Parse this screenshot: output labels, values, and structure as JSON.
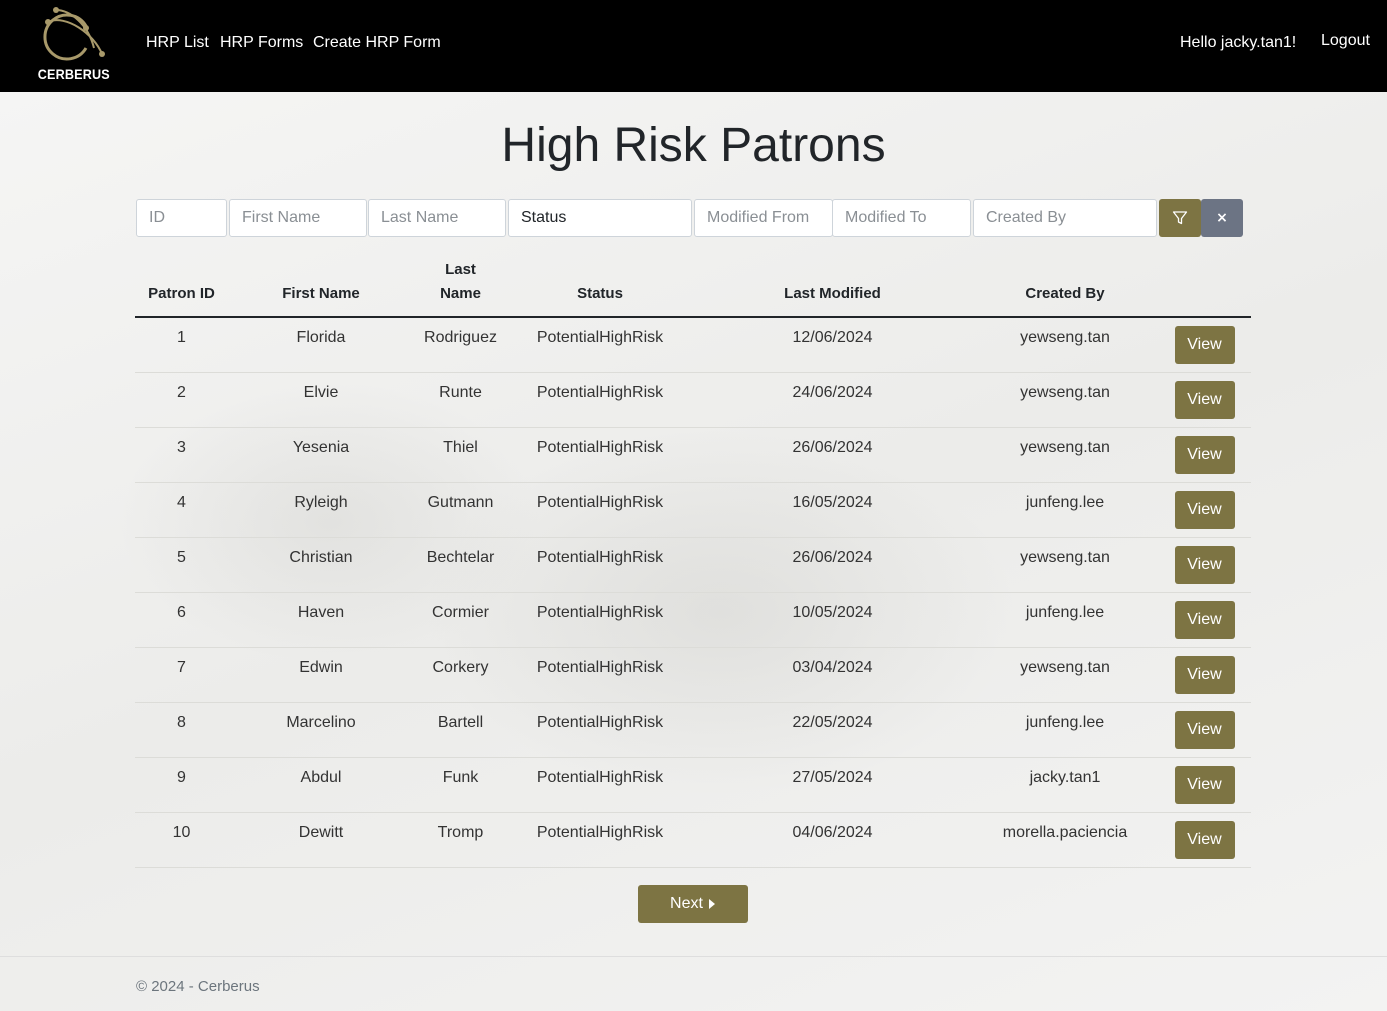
{
  "brand": {
    "name": "CERBERUS",
    "logo_icon": "cerberus-logo-icon"
  },
  "nav": {
    "links": [
      "HRP List",
      "HRP Forms",
      "Create HRP Form"
    ],
    "greeting": "Hello jacky.tan1!",
    "logout": "Logout"
  },
  "page": {
    "title": "High Risk Patrons"
  },
  "filters": {
    "id_placeholder": "ID",
    "first_name_placeholder": "First Name",
    "last_name_placeholder": "Last Name",
    "status_value": "Status",
    "modified_from_placeholder": "Modified From",
    "modified_to_placeholder": "Modified To",
    "created_by_placeholder": "Created By",
    "filter_icon": "filter-icon",
    "clear_label": "×"
  },
  "table": {
    "headers": {
      "patron_id": "Patron ID",
      "first_name": "First Name",
      "last_name_1": "Last",
      "last_name_2": "Name",
      "status": "Status",
      "last_modified": "Last Modified",
      "created_by": "Created By"
    },
    "view_label": "View",
    "rows": [
      {
        "id": "1",
        "first": "Florida",
        "last": "Rodriguez",
        "status": "PotentialHighRisk",
        "modified": "12/06/2024",
        "created_by": "yewseng.tan"
      },
      {
        "id": "2",
        "first": "Elvie",
        "last": "Runte",
        "status": "PotentialHighRisk",
        "modified": "24/06/2024",
        "created_by": "yewseng.tan"
      },
      {
        "id": "3",
        "first": "Yesenia",
        "last": "Thiel",
        "status": "PotentialHighRisk",
        "modified": "26/06/2024",
        "created_by": "yewseng.tan"
      },
      {
        "id": "4",
        "first": "Ryleigh",
        "last": "Gutmann",
        "status": "PotentialHighRisk",
        "modified": "16/05/2024",
        "created_by": "junfeng.lee"
      },
      {
        "id": "5",
        "first": "Christian",
        "last": "Bechtelar",
        "status": "PotentialHighRisk",
        "modified": "26/06/2024",
        "created_by": "yewseng.tan"
      },
      {
        "id": "6",
        "first": "Haven",
        "last": "Cormier",
        "status": "PotentialHighRisk",
        "modified": "10/05/2024",
        "created_by": "junfeng.lee"
      },
      {
        "id": "7",
        "first": "Edwin",
        "last": "Corkery",
        "status": "PotentialHighRisk",
        "modified": "03/04/2024",
        "created_by": "yewseng.tan"
      },
      {
        "id": "8",
        "first": "Marcelino",
        "last": "Bartell",
        "status": "PotentialHighRisk",
        "modified": "22/05/2024",
        "created_by": "junfeng.lee"
      },
      {
        "id": "9",
        "first": "Abdul",
        "last": "Funk",
        "status": "PotentialHighRisk",
        "modified": "27/05/2024",
        "created_by": "jacky.tan1"
      },
      {
        "id": "10",
        "first": "Dewitt",
        "last": "Tromp",
        "status": "PotentialHighRisk",
        "modified": "04/06/2024",
        "created_by": "morella.paciencia"
      }
    ]
  },
  "pagination": {
    "next_label": "Next",
    "next_icon": "caret-right-icon"
  },
  "footer": {
    "text": "© 2024 - Cerberus"
  },
  "colors": {
    "accent": "#7d7443",
    "secondary": "#6c7484",
    "navbar": "#000000"
  }
}
